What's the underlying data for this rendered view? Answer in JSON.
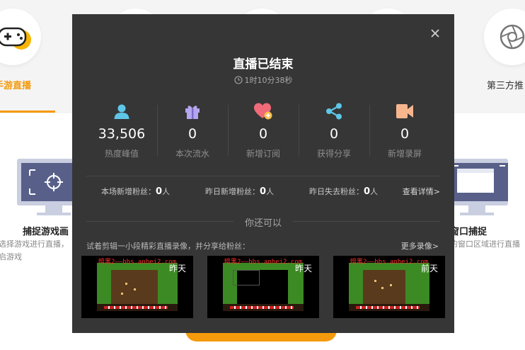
{
  "background": {
    "tabs": [
      {
        "label": "手游直播",
        "icon": "gamepad-icon",
        "active": true
      },
      {
        "label": "第三方推",
        "icon": "film-reel-icon",
        "active": false
      }
    ],
    "cards": [
      {
        "title": "捕捉游戏画",
        "desc": "选择游戏进行直播，启游戏",
        "icon": "target-icon"
      },
      {
        "title": "窗口捕捉",
        "desc": "的窗口区域进行直播",
        "icon": "window-icon"
      }
    ],
    "accent": "#f59a0c"
  },
  "modal": {
    "title": "直播已结束",
    "duration": "1时10分38秒",
    "stats": [
      {
        "icon": "person-icon",
        "value": "33,506",
        "label": "热度峰值",
        "color": "#5ec6e8"
      },
      {
        "icon": "gift-icon",
        "value": "0",
        "label": "本次流水",
        "color": "#b6a6f0"
      },
      {
        "icon": "heart-plus-icon",
        "value": "0",
        "label": "新增订阅",
        "color": "#f06a7a"
      },
      {
        "icon": "share-icon",
        "value": "0",
        "label": "获得分享",
        "color": "#5ec6e8"
      },
      {
        "icon": "video-camera-icon",
        "value": "0",
        "label": "新增录屏",
        "color": "#f7b58e"
      }
    ],
    "fans": [
      {
        "label": "本场新增粉丝：",
        "value": "0",
        "unit": "人"
      },
      {
        "label": "昨日新增粉丝：",
        "value": "0",
        "unit": "人"
      },
      {
        "label": "昨日失去粉丝：",
        "value": "0",
        "unit": "人"
      }
    ],
    "details_link": "查看详情>",
    "section_title": "你还可以",
    "tip": "试着剪辑一小段精彩直播录像，并分享给粉丝：",
    "more_link": "更多录像>",
    "recordings": [
      {
        "watermark": "暗黑2——bbs.anhei2.com",
        "when": "昨天"
      },
      {
        "watermark": "暗黑2——bbs.anhei2.com",
        "when": "昨天"
      },
      {
        "watermark": "暗黑2——bbs.anhei2.com",
        "when": "前天"
      }
    ]
  }
}
